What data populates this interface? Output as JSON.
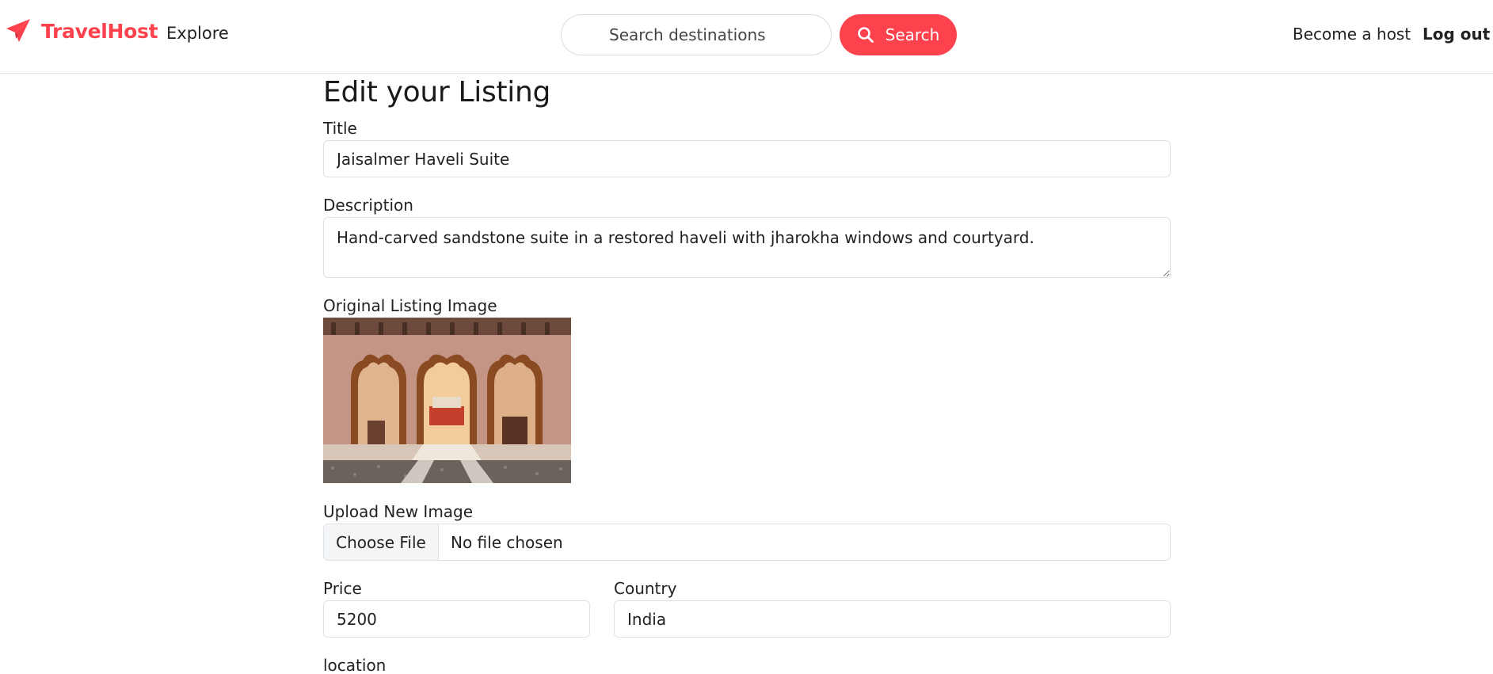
{
  "navbar": {
    "brand_name": "TravelHost",
    "brand_icon": "paper-plane-icon",
    "explore_label": "Explore",
    "search_placeholder": "Search destinations",
    "search_button_label": "Search",
    "search_icon": "magnifier-icon",
    "become_host_label": "Become a host",
    "logout_label": "Log out"
  },
  "form": {
    "heading": "Edit your Listing",
    "title_label": "Title",
    "title_value": "Jaisalmer Haveli Suite",
    "description_label": "Description",
    "description_value": "Hand-carved sandstone suite in a restored haveli with jharokha windows and courtyard.",
    "original_image_label": "Original Listing Image",
    "upload_label": "Upload New Image",
    "choose_file_label": "Choose File",
    "file_status": "No file chosen",
    "price_label": "Price",
    "price_value": "5200",
    "country_label": "Country",
    "country_value": "India",
    "location_label": "location"
  },
  "colors": {
    "brand": "#fe424d",
    "border": "#dee2e6"
  }
}
